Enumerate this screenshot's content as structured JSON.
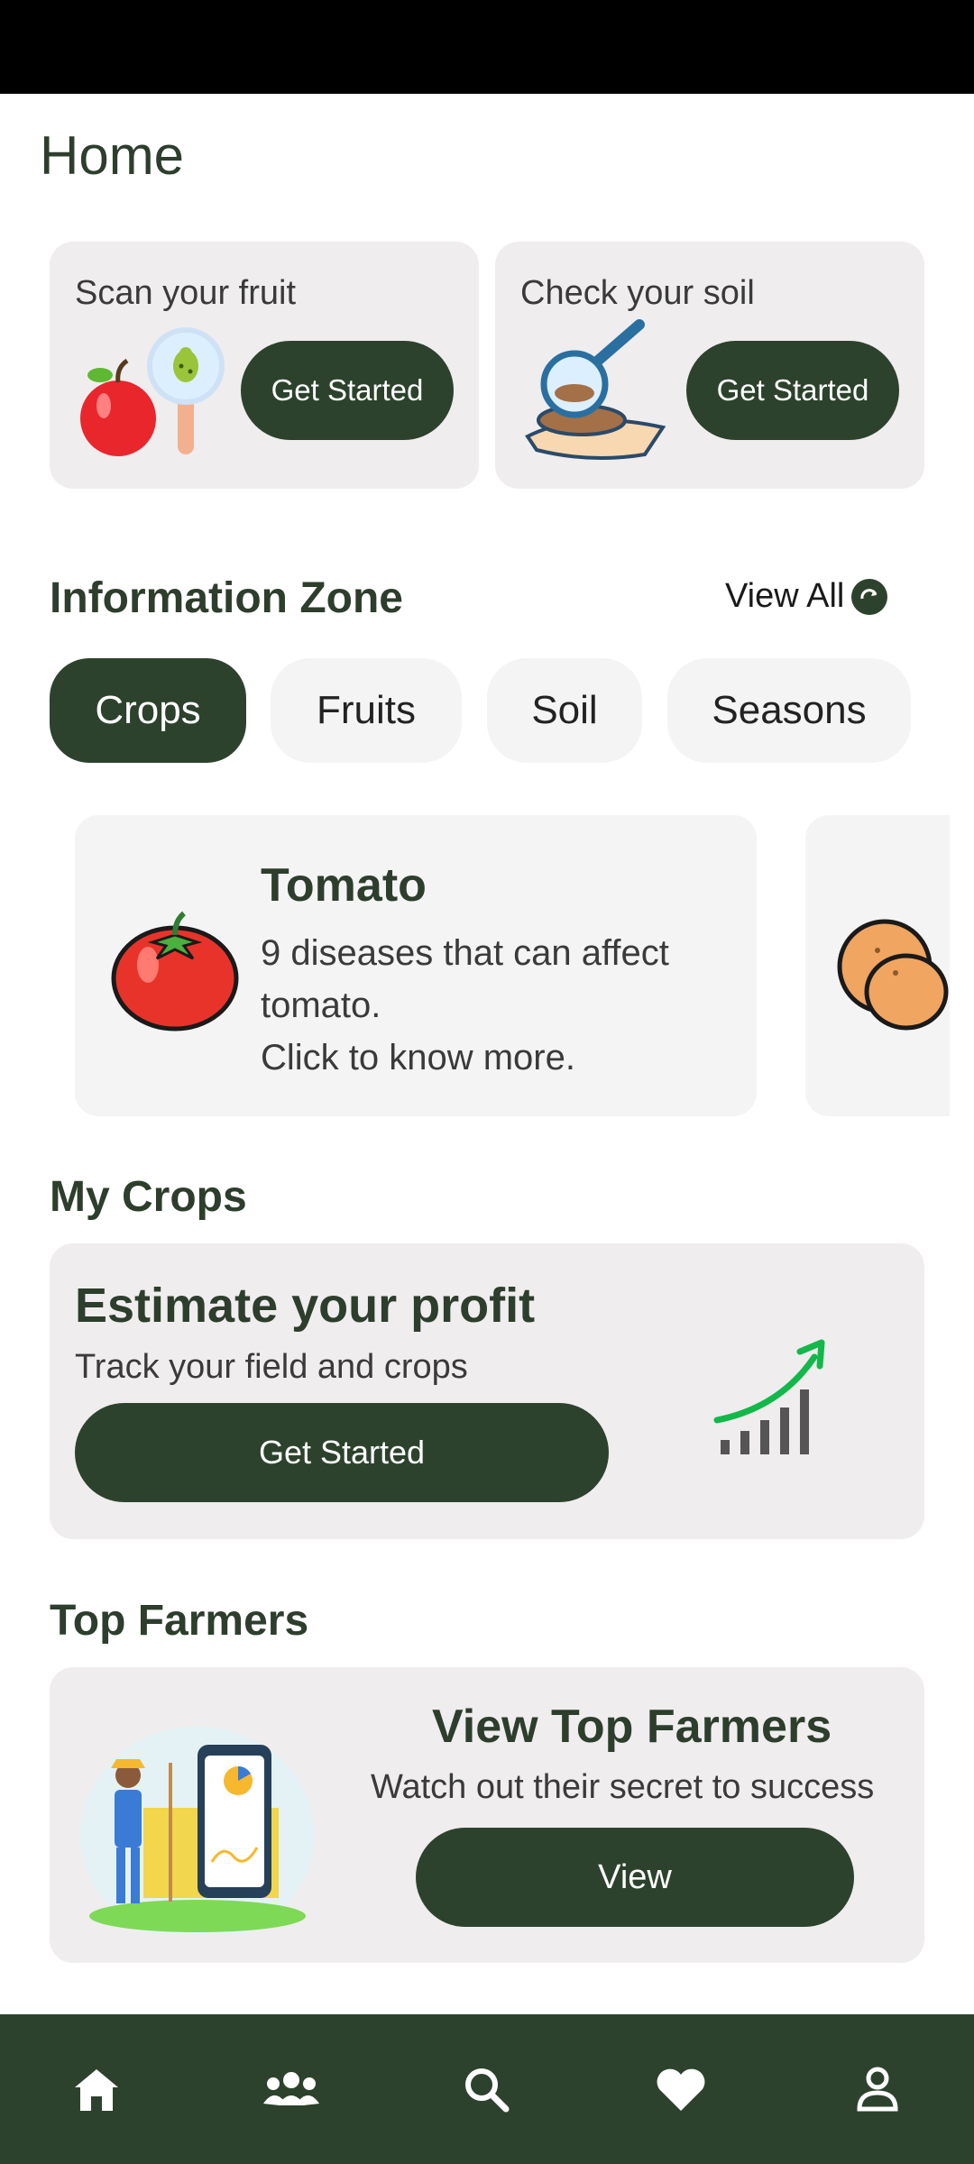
{
  "page": {
    "title": "Home"
  },
  "quick_actions": [
    {
      "title": "Scan your fruit",
      "button": "Get Started",
      "icon": "fruit-scan-illustration"
    },
    {
      "title": "Check your soil",
      "button": "Get Started",
      "icon": "soil-check-illustration"
    }
  ],
  "info_zone": {
    "heading": "Information Zone",
    "view_all": "View All",
    "tabs": [
      "Crops",
      "Fruits",
      "Soil",
      "Seasons"
    ],
    "active_tab": "Crops",
    "cards": [
      {
        "title": "Tomato",
        "line1": "9 diseases that can affect tomato.",
        "line2": "Click to know more.",
        "icon": "tomato-illustration"
      }
    ]
  },
  "my_crops": {
    "heading": "My Crops",
    "card_title": "Estimate your profit",
    "card_subtitle": "Track your field and crops",
    "button": "Get Started"
  },
  "top_farmers": {
    "heading": "Top Farmers",
    "card_title": "View Top Farmers",
    "card_subtitle": "Watch out their secret to success",
    "button": "View"
  },
  "bottom_nav": [
    {
      "name": "home",
      "icon": "home-icon",
      "active": true
    },
    {
      "name": "community",
      "icon": "people-icon"
    },
    {
      "name": "search",
      "icon": "search-icon"
    },
    {
      "name": "favorites",
      "icon": "heart-icon"
    },
    {
      "name": "profile",
      "icon": "user-icon"
    }
  ],
  "colors": {
    "primary": "#2d422d",
    "card_bg": "#efedee",
    "chip_bg": "#f4f4f4"
  }
}
